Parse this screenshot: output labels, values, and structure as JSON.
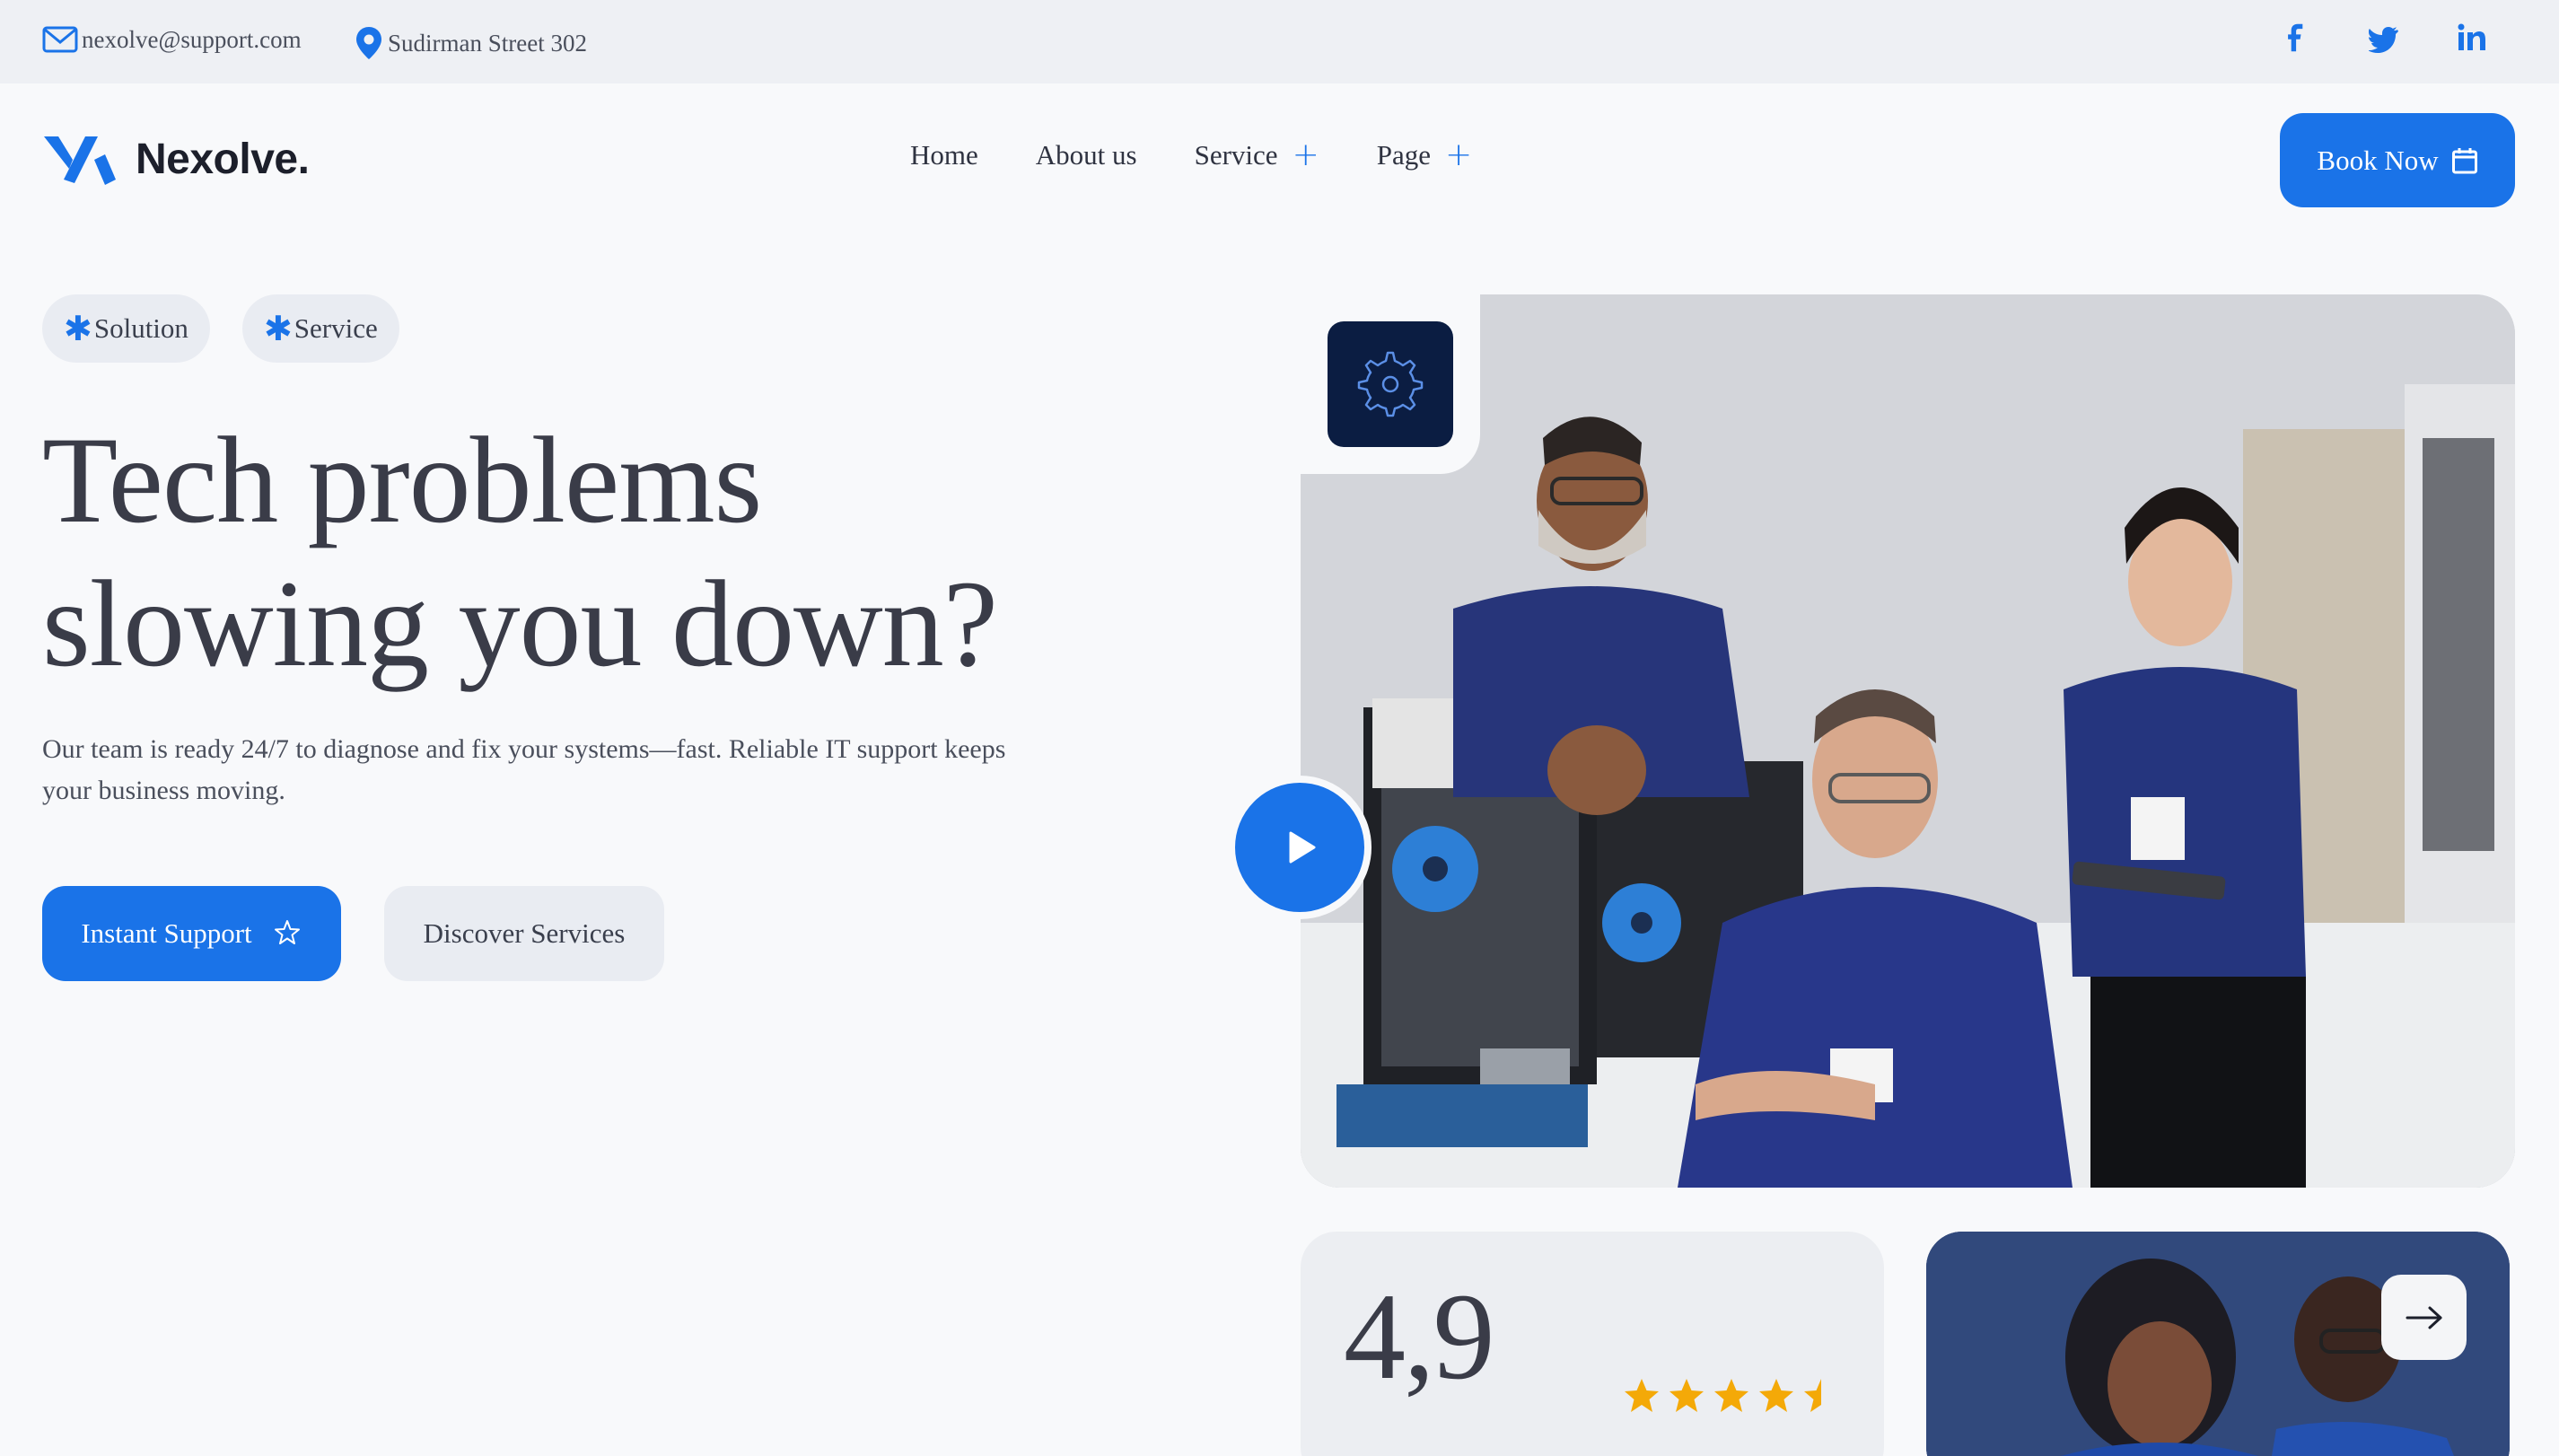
{
  "topbar": {
    "email": "nexolve@support.com",
    "address": "Sudirman Street 302",
    "social": [
      "facebook-icon",
      "twitter-icon",
      "linkedin-icon"
    ]
  },
  "brand": {
    "name": "Nexolve.",
    "accent": "#1a73e8",
    "navy": "#0b1d42"
  },
  "nav": {
    "items": [
      {
        "label": "Home",
        "has_submenu": false
      },
      {
        "label": "About us",
        "has_submenu": false
      },
      {
        "label": "Service",
        "has_submenu": true
      },
      {
        "label": "Page",
        "has_submenu": true
      }
    ],
    "cta": "Book Now"
  },
  "hero": {
    "tags": [
      "Solution",
      "Service"
    ],
    "headline_line1": "Tech problems",
    "headline_line2": "slowing you down?",
    "subtext": "Our team is ready 24/7 to diagnose and fix your systems—fast. Reliable IT support keeps your business moving.",
    "primary_button": "Instant Support",
    "secondary_button": "Discover Services"
  },
  "rating": {
    "value": "4,9",
    "stars": 4.5,
    "star_color": "#f4a908"
  }
}
